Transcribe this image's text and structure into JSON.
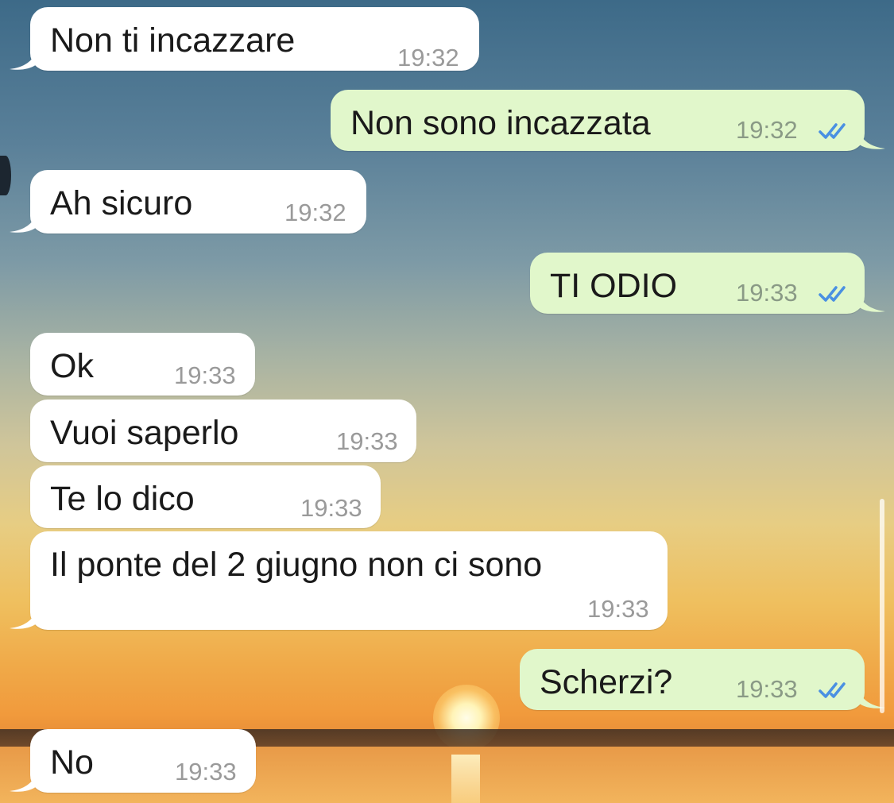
{
  "messages": [
    {
      "text": "Non ti incazzare",
      "time": "19:32",
      "direction": "incoming"
    },
    {
      "text": "Non sono incazzata",
      "time": "19:32",
      "direction": "outgoing",
      "status": "read"
    },
    {
      "text": "Ah sicuro",
      "time": "19:32",
      "direction": "incoming"
    },
    {
      "text": "TI ODIO",
      "time": "19:33",
      "direction": "outgoing",
      "status": "read"
    },
    {
      "text": "Ok",
      "time": "19:33",
      "direction": "incoming"
    },
    {
      "text": "Vuoi saperlo",
      "time": "19:33",
      "direction": "incoming"
    },
    {
      "text": "Te lo dico",
      "time": "19:33",
      "direction": "incoming"
    },
    {
      "text": "Il ponte del 2 giugno non ci sono",
      "time": "19:33",
      "direction": "incoming"
    },
    {
      "text": "Scherzi?",
      "time": "19:33",
      "direction": "outgoing",
      "status": "read"
    },
    {
      "text": "No",
      "time": "19:33",
      "direction": "incoming"
    }
  ],
  "colors": {
    "incoming_bubble": "#ffffff",
    "outgoing_bubble": "#e1f7cb",
    "read_ticks": "#4a90e2",
    "timestamp": "#9a9a9a"
  },
  "icons": {
    "read_status": "double-check-icon",
    "bubble_tail": "bubble-tail-icon"
  }
}
